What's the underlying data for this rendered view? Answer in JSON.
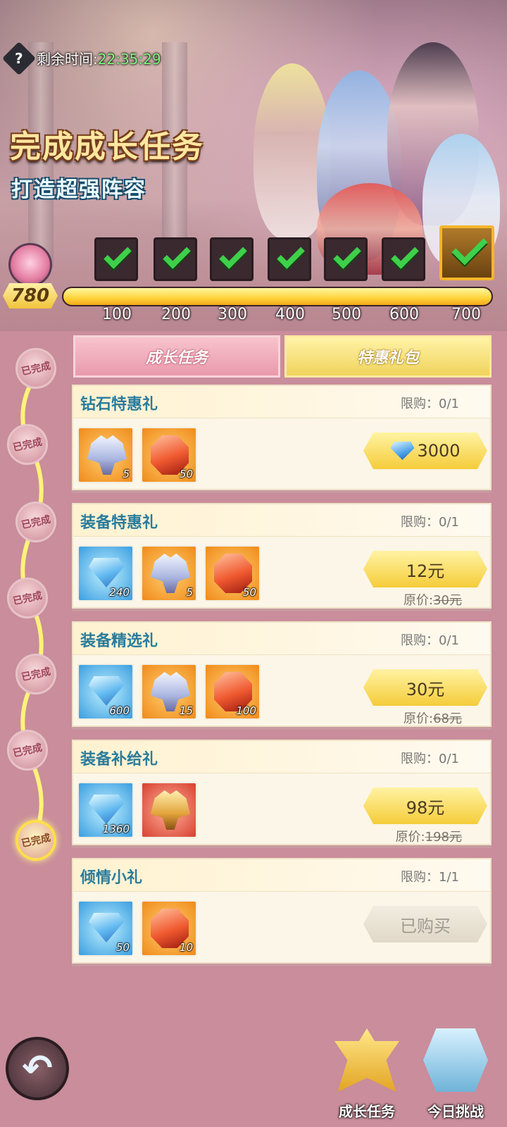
{
  "header": {
    "timer_label": "剩余时间:",
    "timer_value": "22:35:29",
    "title": "完成成长任务",
    "subtitle": "打造超强阵容"
  },
  "progress": {
    "score": "780",
    "fill_fraction": 1.0,
    "milestones": [
      {
        "label": "100",
        "completed": true
      },
      {
        "label": "200",
        "completed": true
      },
      {
        "label": "300",
        "completed": true
      },
      {
        "label": "400",
        "completed": true
      },
      {
        "label": "500",
        "completed": true
      },
      {
        "label": "600",
        "completed": true
      },
      {
        "label": "700",
        "completed": true
      }
    ]
  },
  "timeline": {
    "nodes": [
      "已完成",
      "已完成",
      "已完成",
      "已完成",
      "已完成",
      "已完成",
      "已完成"
    ]
  },
  "tabs": {
    "growth": "成长任务",
    "gift": "特惠礼包"
  },
  "packs": [
    {
      "title": "钻石特惠礼",
      "limit": "限购：0/1",
      "items": [
        {
          "icon": "armor-icon",
          "qty": "5"
        },
        {
          "icon": "ruby-icon",
          "qty": "50"
        }
      ],
      "price": "3000",
      "price_icon": "diamond-icon",
      "original_label": "",
      "original_price": ""
    },
    {
      "title": "装备特惠礼",
      "limit": "限购：0/1",
      "items": [
        {
          "icon": "diamond-icon",
          "qty": "240"
        },
        {
          "icon": "armor-icon",
          "qty": "5"
        },
        {
          "icon": "ruby-icon",
          "qty": "50"
        }
      ],
      "price": "12元",
      "original_label": "原价:",
      "original_price": "30元"
    },
    {
      "title": "装备精选礼",
      "limit": "限购：0/1",
      "items": [
        {
          "icon": "diamond-icon",
          "qty": "600"
        },
        {
          "icon": "armor-icon",
          "qty": "15"
        },
        {
          "icon": "ruby-icon",
          "qty": "100"
        }
      ],
      "price": "30元",
      "original_label": "原价:",
      "original_price": "68元"
    },
    {
      "title": "装备补给礼",
      "limit": "限购：0/1",
      "items": [
        {
          "icon": "diamond-icon",
          "qty": "1360"
        },
        {
          "icon": "gold-armor-icon",
          "qty": ""
        }
      ],
      "price": "98元",
      "original_label": "原价:",
      "original_price": "198元"
    },
    {
      "title": "倾情小礼",
      "limit": "限购：1/1",
      "items": [
        {
          "icon": "diamond-icon",
          "qty": "50"
        },
        {
          "icon": "ruby-icon",
          "qty": "10"
        }
      ],
      "price": "已购买",
      "purchased": true,
      "original_label": "",
      "original_price": ""
    }
  ],
  "bottom_nav": {
    "growth": "成长任务",
    "challenge": "今日挑战"
  },
  "colors": {
    "page_bg": "#c98d9b",
    "gold": "#f5cc3a",
    "title_teal": "#2a7c9c",
    "timer_green": "#7ff27f"
  }
}
